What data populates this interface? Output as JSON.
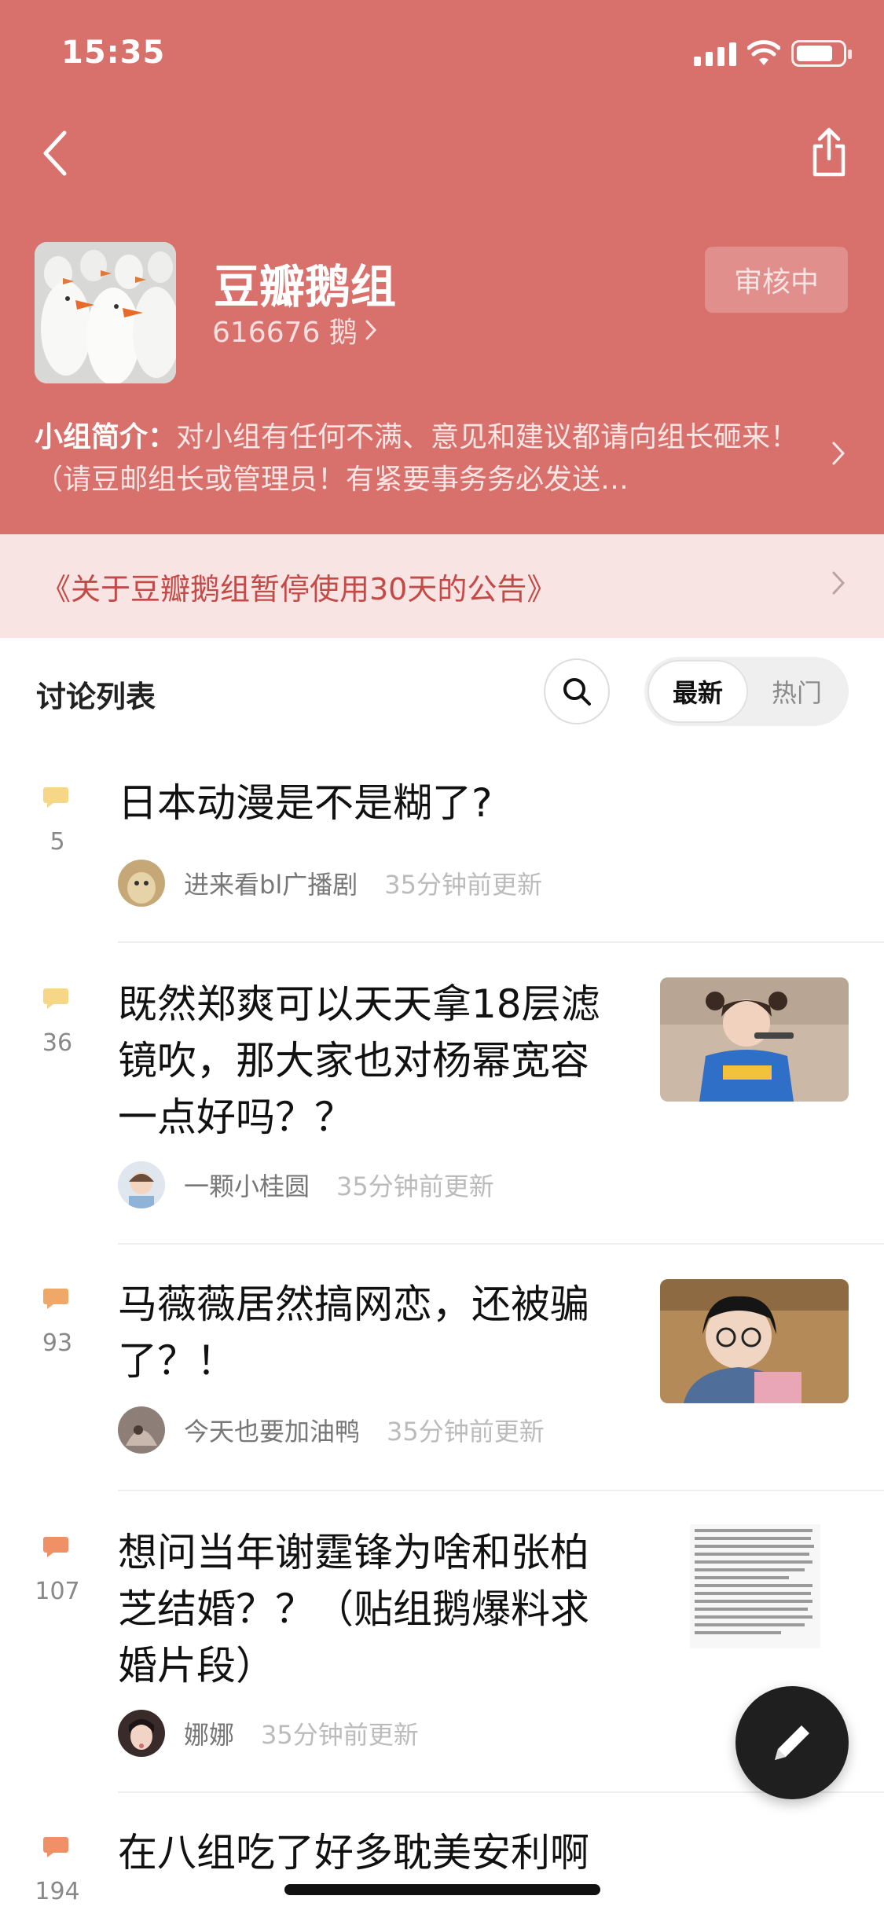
{
  "status_bar": {
    "time": "15:35"
  },
  "group": {
    "name": "豆瓣鹅组",
    "members": "616676 鹅",
    "review_status": "审核中",
    "intro_label": "小组简介：",
    "intro_text": "对小组有任何不满、意见和建议都请向组长砸来！（请豆邮组长或管理员！有紧要事务务必发送…"
  },
  "notice": {
    "text": "《关于豆瓣鹅组暂停使用30天的公告》"
  },
  "list_header": {
    "title": "讨论列表",
    "sort_latest": "最新",
    "sort_hot": "热门"
  },
  "topics": [
    {
      "count": "5",
      "title": "日本动漫是不是糊了?",
      "author": "进来看bl广播剧",
      "time": "35分钟前更新"
    },
    {
      "count": "36",
      "title": "既然郑爽可以天天拿18层滤镜吹，那大家也对杨幂宽容一点好吗？？",
      "author": "一颗小桂圆",
      "time": "35分钟前更新"
    },
    {
      "count": "93",
      "title": "马薇薇居然搞网恋，还被骗了？！",
      "author": "今天也要加油鸭",
      "time": "35分钟前更新"
    },
    {
      "count": "107",
      "title": "想问当年谢霆锋为啥和张柏芝结婚？？（贴组鹅爆料求婚片段）",
      "author": "娜娜",
      "time": "35分钟前更新"
    },
    {
      "count": "194",
      "title": "在八组吃了好多耽美安利啊",
      "author": "",
      "time": ""
    }
  ],
  "colors": {
    "header_bg": "#d8706c",
    "notice_bg": "#f9e4e4",
    "notice_text": "#c24a47",
    "comment_icon_light": "#f6d78a",
    "comment_icon_hot": "#ef9066"
  }
}
